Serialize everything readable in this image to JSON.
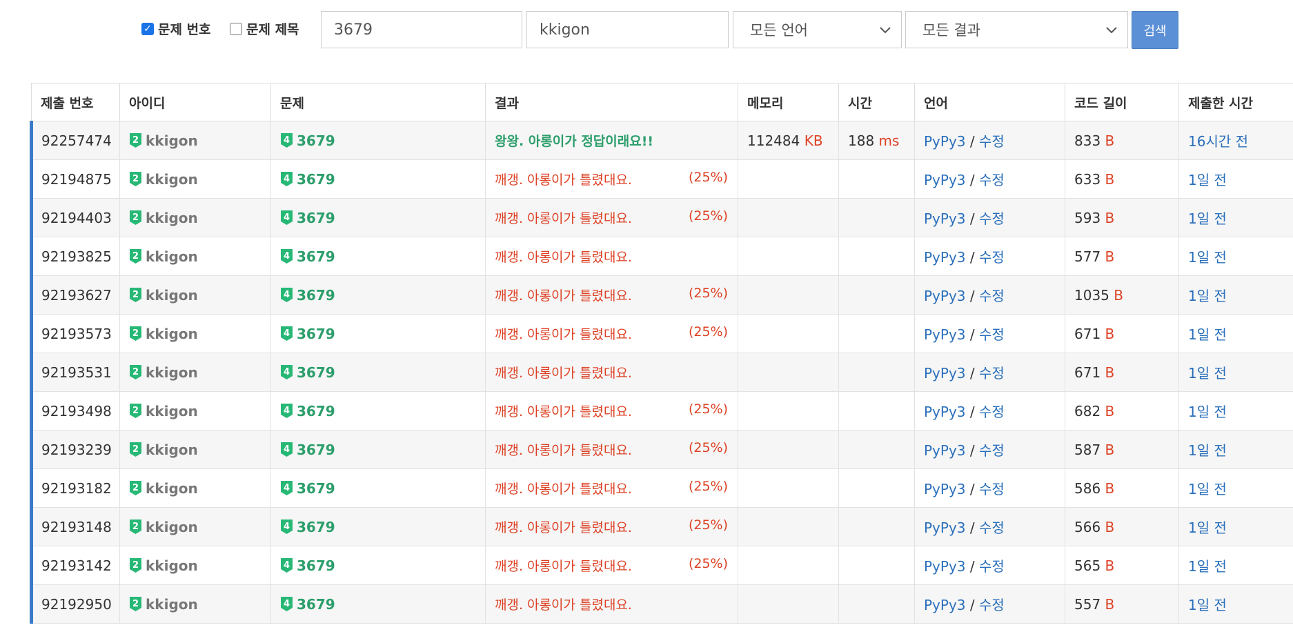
{
  "filters": {
    "problem_number": {
      "label": "문제 번호",
      "checked": true
    },
    "problem_title": {
      "label": "문제 제목",
      "checked": false
    },
    "problem_value": "3679",
    "user_value": "kkigon",
    "language_select": "모든 언어",
    "result_select": "모든 결과",
    "search_button": "검색"
  },
  "table": {
    "headers": [
      "제출 번호",
      "아이디",
      "문제",
      "결과",
      "메모리",
      "시간",
      "언어",
      "코드 길이",
      "제출한 시간"
    ],
    "rows": [
      {
        "id": "92257474",
        "user": "kkigon",
        "user_tier": "2",
        "problem": "3679",
        "problem_tier": "4",
        "result": "왕왕. 아롱이가 정답이래요!!",
        "accepted": true,
        "score": "",
        "memory": "112484",
        "memory_unit": "KB",
        "time": "188",
        "time_unit": "ms",
        "language": "PyPy3",
        "sep": "/",
        "edit": "수정",
        "length": "833",
        "length_unit": "B",
        "submitted": "16시간 전"
      },
      {
        "id": "92194875",
        "user": "kkigon",
        "user_tier": "2",
        "problem": "3679",
        "problem_tier": "4",
        "result": "깨갱. 아롱이가 틀렸대요.",
        "accepted": false,
        "score": "(25%)",
        "memory": "",
        "memory_unit": "",
        "time": "",
        "time_unit": "",
        "language": "PyPy3",
        "sep": "/",
        "edit": "수정",
        "length": "633",
        "length_unit": "B",
        "submitted": "1일 전"
      },
      {
        "id": "92194403",
        "user": "kkigon",
        "user_tier": "2",
        "problem": "3679",
        "problem_tier": "4",
        "result": "깨갱. 아롱이가 틀렸대요.",
        "accepted": false,
        "score": "(25%)",
        "memory": "",
        "memory_unit": "",
        "time": "",
        "time_unit": "",
        "language": "PyPy3",
        "sep": "/",
        "edit": "수정",
        "length": "593",
        "length_unit": "B",
        "submitted": "1일 전"
      },
      {
        "id": "92193825",
        "user": "kkigon",
        "user_tier": "2",
        "problem": "3679",
        "problem_tier": "4",
        "result": "깨갱. 아롱이가 틀렸대요.",
        "accepted": false,
        "score": "",
        "memory": "",
        "memory_unit": "",
        "time": "",
        "time_unit": "",
        "language": "PyPy3",
        "sep": "/",
        "edit": "수정",
        "length": "577",
        "length_unit": "B",
        "submitted": "1일 전"
      },
      {
        "id": "92193627",
        "user": "kkigon",
        "user_tier": "2",
        "problem": "3679",
        "problem_tier": "4",
        "result": "깨갱. 아롱이가 틀렸대요.",
        "accepted": false,
        "score": "(25%)",
        "memory": "",
        "memory_unit": "",
        "time": "",
        "time_unit": "",
        "language": "PyPy3",
        "sep": "/",
        "edit": "수정",
        "length": "1035",
        "length_unit": "B",
        "submitted": "1일 전"
      },
      {
        "id": "92193573",
        "user": "kkigon",
        "user_tier": "2",
        "problem": "3679",
        "problem_tier": "4",
        "result": "깨갱. 아롱이가 틀렸대요.",
        "accepted": false,
        "score": "(25%)",
        "memory": "",
        "memory_unit": "",
        "time": "",
        "time_unit": "",
        "language": "PyPy3",
        "sep": "/",
        "edit": "수정",
        "length": "671",
        "length_unit": "B",
        "submitted": "1일 전"
      },
      {
        "id": "92193531",
        "user": "kkigon",
        "user_tier": "2",
        "problem": "3679",
        "problem_tier": "4",
        "result": "깨갱. 아롱이가 틀렸대요.",
        "accepted": false,
        "score": "",
        "memory": "",
        "memory_unit": "",
        "time": "",
        "time_unit": "",
        "language": "PyPy3",
        "sep": "/",
        "edit": "수정",
        "length": "671",
        "length_unit": "B",
        "submitted": "1일 전"
      },
      {
        "id": "92193498",
        "user": "kkigon",
        "user_tier": "2",
        "problem": "3679",
        "problem_tier": "4",
        "result": "깨갱. 아롱이가 틀렸대요.",
        "accepted": false,
        "score": "(25%)",
        "memory": "",
        "memory_unit": "",
        "time": "",
        "time_unit": "",
        "language": "PyPy3",
        "sep": "/",
        "edit": "수정",
        "length": "682",
        "length_unit": "B",
        "submitted": "1일 전"
      },
      {
        "id": "92193239",
        "user": "kkigon",
        "user_tier": "2",
        "problem": "3679",
        "problem_tier": "4",
        "result": "깨갱. 아롱이가 틀렸대요.",
        "accepted": false,
        "score": "(25%)",
        "memory": "",
        "memory_unit": "",
        "time": "",
        "time_unit": "",
        "language": "PyPy3",
        "sep": "/",
        "edit": "수정",
        "length": "587",
        "length_unit": "B",
        "submitted": "1일 전"
      },
      {
        "id": "92193182",
        "user": "kkigon",
        "user_tier": "2",
        "problem": "3679",
        "problem_tier": "4",
        "result": "깨갱. 아롱이가 틀렸대요.",
        "accepted": false,
        "score": "(25%)",
        "memory": "",
        "memory_unit": "",
        "time": "",
        "time_unit": "",
        "language": "PyPy3",
        "sep": "/",
        "edit": "수정",
        "length": "586",
        "length_unit": "B",
        "submitted": "1일 전"
      },
      {
        "id": "92193148",
        "user": "kkigon",
        "user_tier": "2",
        "problem": "3679",
        "problem_tier": "4",
        "result": "깨갱. 아롱이가 틀렸대요.",
        "accepted": false,
        "score": "(25%)",
        "memory": "",
        "memory_unit": "",
        "time": "",
        "time_unit": "",
        "language": "PyPy3",
        "sep": "/",
        "edit": "수정",
        "length": "566",
        "length_unit": "B",
        "submitted": "1일 전"
      },
      {
        "id": "92193142",
        "user": "kkigon",
        "user_tier": "2",
        "problem": "3679",
        "problem_tier": "4",
        "result": "깨갱. 아롱이가 틀렸대요.",
        "accepted": false,
        "score": "(25%)",
        "memory": "",
        "memory_unit": "",
        "time": "",
        "time_unit": "",
        "language": "PyPy3",
        "sep": "/",
        "edit": "수정",
        "length": "565",
        "length_unit": "B",
        "submitted": "1일 전"
      },
      {
        "id": "92192950",
        "user": "kkigon",
        "user_tier": "2",
        "problem": "3679",
        "problem_tier": "4",
        "result": "깨갱. 아롱이가 틀렸대요.",
        "accepted": false,
        "score": "",
        "memory": "",
        "memory_unit": "",
        "time": "",
        "time_unit": "",
        "language": "PyPy3",
        "sep": "/",
        "edit": "수정",
        "length": "557",
        "length_unit": "B",
        "submitted": "1일 전"
      }
    ]
  },
  "colors": {
    "accepted": "#2c9e6b",
    "wrong": "#dd4124",
    "link": "#2a6fbb",
    "row_accent": "#3a7bc8",
    "search_button": "#5b8fd6"
  },
  "icons": {
    "checkbox_checked": "checkmark-icon",
    "dropdown": "chevron-down-icon",
    "user_tier": "tier-badge-icon",
    "problem_tier": "tier-badge-icon"
  }
}
